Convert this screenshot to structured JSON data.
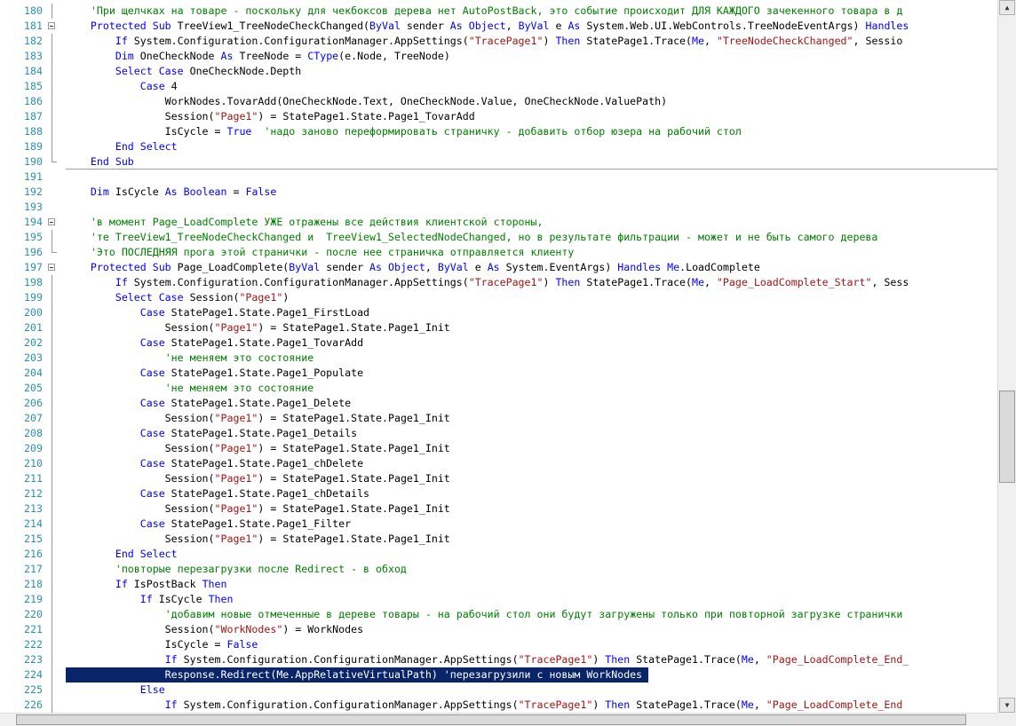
{
  "colors": {
    "keyword": "#0000ff",
    "string": "#a31515",
    "comment": "#008000",
    "line_number": "#2b91af",
    "selection": "#0a246a"
  },
  "editor": {
    "selected_line": 224,
    "lines": [
      {
        "n": "180",
        "fold": "line",
        "tokens": [
          {
            "t": "    "
          },
          {
            "t": "'При щелчках на товаре - поскольку для чекбоксов дерева нет AutoPostBack, это событие происходит ДЛЯ КАЖДОГО зачекенного товара в д",
            "c": "cmt"
          }
        ]
      },
      {
        "n": "181",
        "fold": "box",
        "tokens": [
          {
            "t": "    "
          },
          {
            "t": "Protected Sub",
            "c": "kw"
          },
          {
            "t": " TreeView1_TreeNodeCheckChanged("
          },
          {
            "t": "ByVal",
            "c": "kw"
          },
          {
            "t": " sender "
          },
          {
            "t": "As Object",
            "c": "kw"
          },
          {
            "t": ", "
          },
          {
            "t": "ByVal",
            "c": "kw"
          },
          {
            "t": " e "
          },
          {
            "t": "As",
            "c": "kw"
          },
          {
            "t": " System.Web.UI.WebControls.TreeNodeEventArgs) "
          },
          {
            "t": "Handles",
            "c": "kw"
          }
        ]
      },
      {
        "n": "182",
        "fold": "line",
        "tokens": [
          {
            "t": "        "
          },
          {
            "t": "If",
            "c": "kw"
          },
          {
            "t": " System.Configuration.ConfigurationManager.AppSettings("
          },
          {
            "t": "\"TracePage1\"",
            "c": "str"
          },
          {
            "t": ") "
          },
          {
            "t": "Then",
            "c": "kw"
          },
          {
            "t": " StatePage1.Trace("
          },
          {
            "t": "Me",
            "c": "kw"
          },
          {
            "t": ", "
          },
          {
            "t": "\"TreeNodeCheckChanged\"",
            "c": "str"
          },
          {
            "t": ", Sessio"
          }
        ]
      },
      {
        "n": "183",
        "fold": "line",
        "tokens": [
          {
            "t": "        "
          },
          {
            "t": "Dim",
            "c": "kw"
          },
          {
            "t": " OneCheckNode "
          },
          {
            "t": "As",
            "c": "kw"
          },
          {
            "t": " TreeNode = "
          },
          {
            "t": "CType",
            "c": "kw"
          },
          {
            "t": "(e.Node, TreeNode)"
          }
        ]
      },
      {
        "n": "184",
        "fold": "line",
        "tokens": [
          {
            "t": "        "
          },
          {
            "t": "Select Case",
            "c": "kw"
          },
          {
            "t": " OneCheckNode.Depth"
          }
        ]
      },
      {
        "n": "185",
        "fold": "line",
        "tokens": [
          {
            "t": "            "
          },
          {
            "t": "Case",
            "c": "kw"
          },
          {
            "t": " 4"
          }
        ]
      },
      {
        "n": "186",
        "fold": "line",
        "tokens": [
          {
            "t": "                WorkNodes.TovarAdd(OneCheckNode.Text, OneCheckNode.Value, OneCheckNode.ValuePath)"
          }
        ]
      },
      {
        "n": "187",
        "fold": "line",
        "tokens": [
          {
            "t": "                Session("
          },
          {
            "t": "\"Page1\"",
            "c": "str"
          },
          {
            "t": ") = StatePage1.State.Page1_TovarAdd"
          }
        ]
      },
      {
        "n": "188",
        "fold": "line",
        "tokens": [
          {
            "t": "                IsCycle = "
          },
          {
            "t": "True",
            "c": "kw"
          },
          {
            "t": "  "
          },
          {
            "t": "'надо заново переформировать страничку - добавить отбор юзера на рабочий стол",
            "c": "cmt"
          }
        ]
      },
      {
        "n": "189",
        "fold": "line",
        "tokens": [
          {
            "t": "        "
          },
          {
            "t": "End Select",
            "c": "kw"
          }
        ]
      },
      {
        "n": "190",
        "fold": "end",
        "tokens": [
          {
            "t": "    "
          },
          {
            "t": "End Sub",
            "c": "kw"
          }
        ]
      },
      {
        "n": "191",
        "fold": "none",
        "tokens": [
          {
            "t": ""
          }
        ]
      },
      {
        "n": "192",
        "fold": "none",
        "tokens": [
          {
            "t": "    "
          },
          {
            "t": "Dim",
            "c": "kw"
          },
          {
            "t": " IsCycle "
          },
          {
            "t": "As Boolean",
            "c": "kw"
          },
          {
            "t": " = "
          },
          {
            "t": "False",
            "c": "kw"
          }
        ]
      },
      {
        "n": "193",
        "fold": "none",
        "tokens": [
          {
            "t": ""
          }
        ]
      },
      {
        "n": "194",
        "fold": "box",
        "tokens": [
          {
            "t": "    "
          },
          {
            "t": "'в момент Page_LoadComplete УЖЕ отражены все действия клиентской стороны,",
            "c": "cmt"
          }
        ]
      },
      {
        "n": "195",
        "fold": "line",
        "tokens": [
          {
            "t": "    "
          },
          {
            "t": "'те TreeView1_TreeNodeCheckChanged и  TreeView1_SelectedNodeChanged, но в результате фильтрации - может и не быть самого дерева",
            "c": "cmt"
          }
        ]
      },
      {
        "n": "196",
        "fold": "end",
        "tokens": [
          {
            "t": "    "
          },
          {
            "t": "'Это ПОСЛЕДНЯЯ прога этой странички - после нее страничка отправляется клиенту",
            "c": "cmt"
          }
        ]
      },
      {
        "n": "197",
        "fold": "box",
        "tokens": [
          {
            "t": "    "
          },
          {
            "t": "Protected Sub",
            "c": "kw"
          },
          {
            "t": " Page_LoadComplete("
          },
          {
            "t": "ByVal",
            "c": "kw"
          },
          {
            "t": " sender "
          },
          {
            "t": "As Object",
            "c": "kw"
          },
          {
            "t": ", "
          },
          {
            "t": "ByVal",
            "c": "kw"
          },
          {
            "t": " e "
          },
          {
            "t": "As",
            "c": "kw"
          },
          {
            "t": " System.EventArgs) "
          },
          {
            "t": "Handles Me",
            "c": "kw"
          },
          {
            "t": ".LoadComplete"
          }
        ]
      },
      {
        "n": "198",
        "fold": "line",
        "tokens": [
          {
            "t": "        "
          },
          {
            "t": "If",
            "c": "kw"
          },
          {
            "t": " System.Configuration.ConfigurationManager.AppSettings("
          },
          {
            "t": "\"TracePage1\"",
            "c": "str"
          },
          {
            "t": ") "
          },
          {
            "t": "Then",
            "c": "kw"
          },
          {
            "t": " StatePage1.Trace("
          },
          {
            "t": "Me",
            "c": "kw"
          },
          {
            "t": ", "
          },
          {
            "t": "\"Page_LoadComplete_Start\"",
            "c": "str"
          },
          {
            "t": ", Sess"
          }
        ]
      },
      {
        "n": "199",
        "fold": "line",
        "tokens": [
          {
            "t": "        "
          },
          {
            "t": "Select Case",
            "c": "kw"
          },
          {
            "t": " Session("
          },
          {
            "t": "\"Page1\"",
            "c": "str"
          },
          {
            "t": ")"
          }
        ]
      },
      {
        "n": "200",
        "fold": "line",
        "tokens": [
          {
            "t": "            "
          },
          {
            "t": "Case",
            "c": "kw"
          },
          {
            "t": " StatePage1.State.Page1_FirstLoad"
          }
        ]
      },
      {
        "n": "201",
        "fold": "line",
        "tokens": [
          {
            "t": "                Session("
          },
          {
            "t": "\"Page1\"",
            "c": "str"
          },
          {
            "t": ") = StatePage1.State.Page1_Init"
          }
        ]
      },
      {
        "n": "202",
        "fold": "line",
        "tokens": [
          {
            "t": "            "
          },
          {
            "t": "Case",
            "c": "kw"
          },
          {
            "t": " StatePage1.State.Page1_TovarAdd"
          }
        ]
      },
      {
        "n": "203",
        "fold": "line",
        "tokens": [
          {
            "t": "                "
          },
          {
            "t": "'не меняем это состояние",
            "c": "cmt"
          }
        ]
      },
      {
        "n": "204",
        "fold": "line",
        "tokens": [
          {
            "t": "            "
          },
          {
            "t": "Case",
            "c": "kw"
          },
          {
            "t": " StatePage1.State.Page1_Populate"
          }
        ]
      },
      {
        "n": "205",
        "fold": "line",
        "tokens": [
          {
            "t": "                "
          },
          {
            "t": "'не меняем это состояние",
            "c": "cmt"
          }
        ]
      },
      {
        "n": "206",
        "fold": "line",
        "tokens": [
          {
            "t": "            "
          },
          {
            "t": "Case",
            "c": "kw"
          },
          {
            "t": " StatePage1.State.Page1_Delete"
          }
        ]
      },
      {
        "n": "207",
        "fold": "line",
        "tokens": [
          {
            "t": "                Session("
          },
          {
            "t": "\"Page1\"",
            "c": "str"
          },
          {
            "t": ") = StatePage1.State.Page1_Init"
          }
        ]
      },
      {
        "n": "208",
        "fold": "line",
        "tokens": [
          {
            "t": "            "
          },
          {
            "t": "Case",
            "c": "kw"
          },
          {
            "t": " StatePage1.State.Page1_Details"
          }
        ]
      },
      {
        "n": "209",
        "fold": "line",
        "tokens": [
          {
            "t": "                Session("
          },
          {
            "t": "\"Page1\"",
            "c": "str"
          },
          {
            "t": ") = StatePage1.State.Page1_Init"
          }
        ]
      },
      {
        "n": "210",
        "fold": "line",
        "tokens": [
          {
            "t": "            "
          },
          {
            "t": "Case",
            "c": "kw"
          },
          {
            "t": " StatePage1.State.Page1_chDelete"
          }
        ]
      },
      {
        "n": "211",
        "fold": "line",
        "tokens": [
          {
            "t": "                Session("
          },
          {
            "t": "\"Page1\"",
            "c": "str"
          },
          {
            "t": ") = StatePage1.State.Page1_Init"
          }
        ]
      },
      {
        "n": "212",
        "fold": "line",
        "tokens": [
          {
            "t": "            "
          },
          {
            "t": "Case",
            "c": "kw"
          },
          {
            "t": " StatePage1.State.Page1_chDetails"
          }
        ]
      },
      {
        "n": "213",
        "fold": "line",
        "tokens": [
          {
            "t": "                Session("
          },
          {
            "t": "\"Page1\"",
            "c": "str"
          },
          {
            "t": ") = StatePage1.State.Page1_Init"
          }
        ]
      },
      {
        "n": "214",
        "fold": "line",
        "tokens": [
          {
            "t": "            "
          },
          {
            "t": "Case",
            "c": "kw"
          },
          {
            "t": " StatePage1.State.Page1_Filter"
          }
        ]
      },
      {
        "n": "215",
        "fold": "line",
        "tokens": [
          {
            "t": "                Session("
          },
          {
            "t": "\"Page1\"",
            "c": "str"
          },
          {
            "t": ") = StatePage1.State.Page1_Init"
          }
        ]
      },
      {
        "n": "216",
        "fold": "line",
        "tokens": [
          {
            "t": "        "
          },
          {
            "t": "End Select",
            "c": "kw"
          }
        ]
      },
      {
        "n": "217",
        "fold": "line",
        "tokens": [
          {
            "t": "        "
          },
          {
            "t": "'повторые перезагрузки после Redirect - в обход",
            "c": "cmt"
          }
        ]
      },
      {
        "n": "218",
        "fold": "line",
        "tokens": [
          {
            "t": "        "
          },
          {
            "t": "If",
            "c": "kw"
          },
          {
            "t": " IsPostBack "
          },
          {
            "t": "Then",
            "c": "kw"
          }
        ]
      },
      {
        "n": "219",
        "fold": "line",
        "tokens": [
          {
            "t": "            "
          },
          {
            "t": "If",
            "c": "kw"
          },
          {
            "t": " IsCycle "
          },
          {
            "t": "Then",
            "c": "kw"
          }
        ]
      },
      {
        "n": "220",
        "fold": "line",
        "tokens": [
          {
            "t": "                "
          },
          {
            "t": "'добавим новые отмеченные в дереве товары - на рабочий стол они будут загружены только при повторной загрузке странички",
            "c": "cmt"
          }
        ]
      },
      {
        "n": "221",
        "fold": "line",
        "tokens": [
          {
            "t": "                Session("
          },
          {
            "t": "\"WorkNodes\"",
            "c": "str"
          },
          {
            "t": ") = WorkNodes"
          }
        ]
      },
      {
        "n": "222",
        "fold": "line",
        "tokens": [
          {
            "t": "                IsCycle = "
          },
          {
            "t": "False",
            "c": "kw"
          }
        ]
      },
      {
        "n": "223",
        "fold": "line",
        "tokens": [
          {
            "t": "                "
          },
          {
            "t": "If",
            "c": "kw"
          },
          {
            "t": " System.Configuration.ConfigurationManager.AppSettings("
          },
          {
            "t": "\"TracePage1\"",
            "c": "str"
          },
          {
            "t": ") "
          },
          {
            "t": "Then",
            "c": "kw"
          },
          {
            "t": " StatePage1.Trace("
          },
          {
            "t": "Me",
            "c": "kw"
          },
          {
            "t": ", "
          },
          {
            "t": "\"Page_LoadComplete_End_",
            "c": "str"
          }
        ]
      },
      {
        "n": "224",
        "fold": "line",
        "tokens": [
          {
            "t": "                Response.Redirect(Me.AppRelativeVirtualPath) 'перезагрузили с новым WorkNodes "
          }
        ]
      },
      {
        "n": "225",
        "fold": "line",
        "tokens": [
          {
            "t": "            "
          },
          {
            "t": "Else",
            "c": "kw"
          }
        ]
      },
      {
        "n": "226",
        "fold": "line",
        "tokens": [
          {
            "t": "                "
          },
          {
            "t": "If",
            "c": "kw"
          },
          {
            "t": " System.Configuration.ConfigurationManager.AppSettings("
          },
          {
            "t": "\"TracePage1\"",
            "c": "str"
          },
          {
            "t": ") "
          },
          {
            "t": "Then",
            "c": "kw"
          },
          {
            "t": " StatePage1.Trace("
          },
          {
            "t": "Me",
            "c": "kw"
          },
          {
            "t": ", "
          },
          {
            "t": "\"Page_LoadComplete_End",
            "c": "str"
          }
        ]
      }
    ]
  }
}
